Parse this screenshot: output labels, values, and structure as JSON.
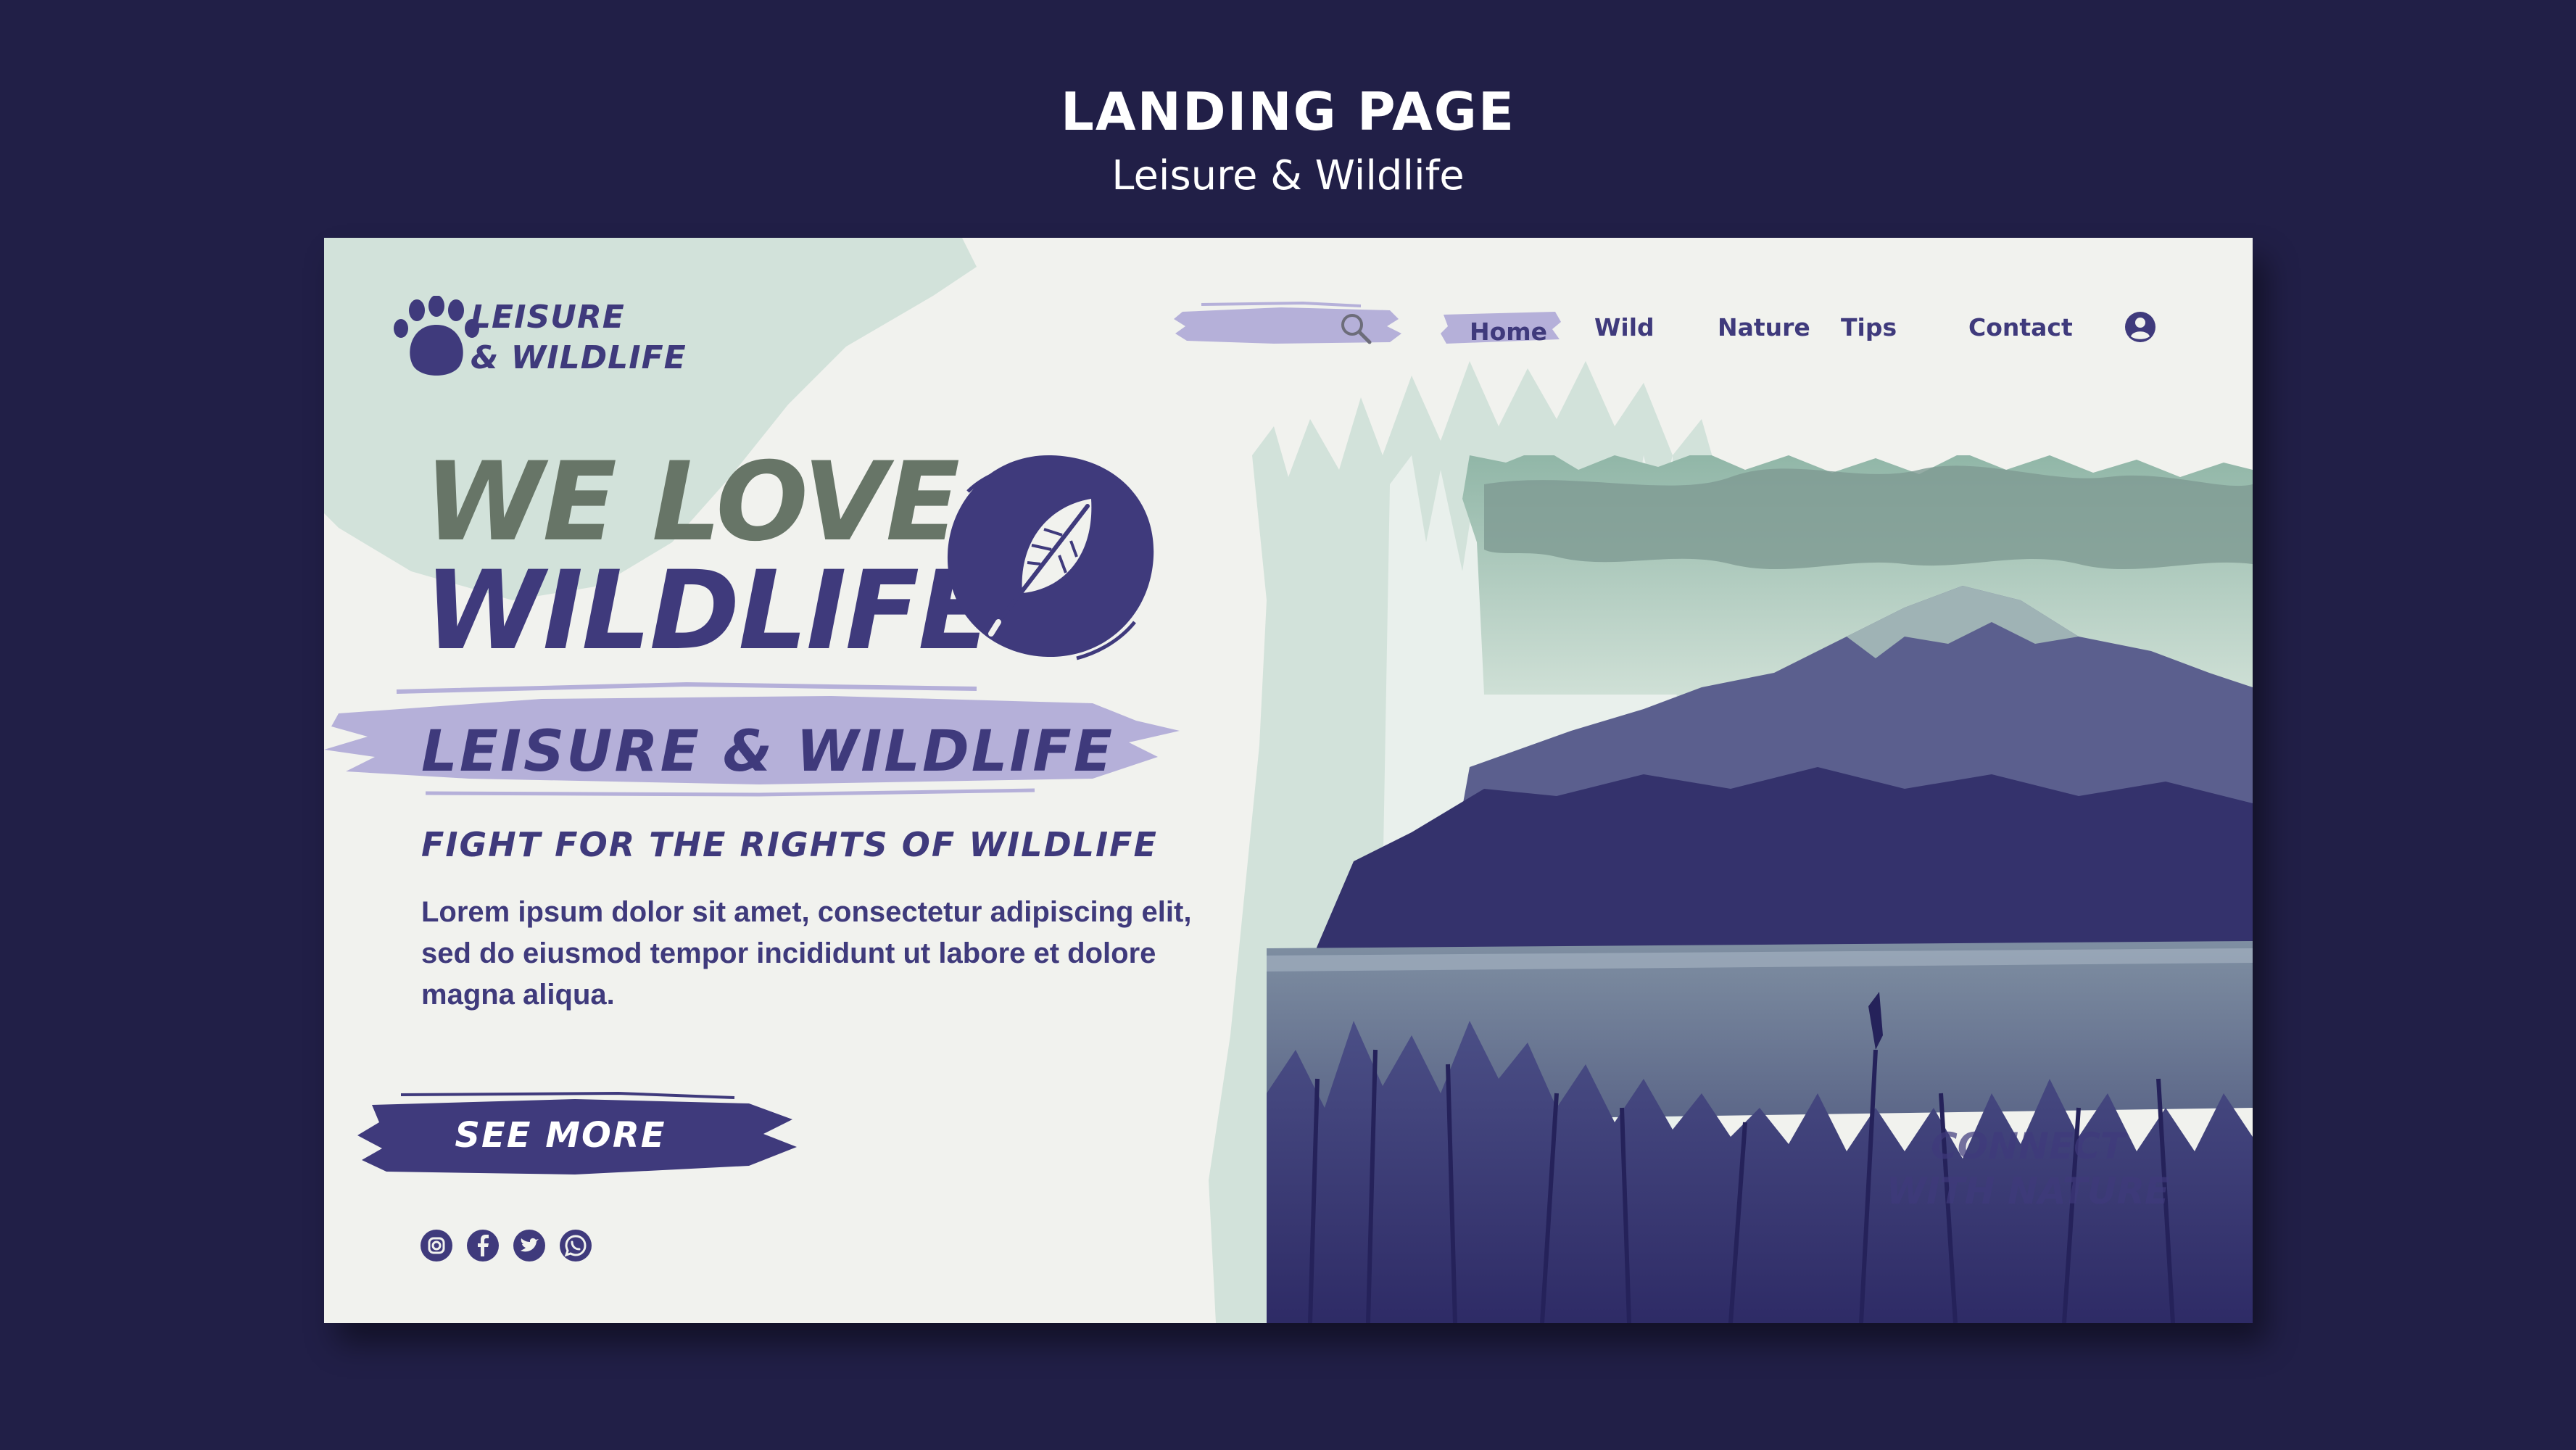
{
  "showcase": {
    "title": "LANDING PAGE",
    "subtitle": "Leisure & Wildlife"
  },
  "brand": {
    "line1": "LEISURE",
    "line2": "& WILDLIFE"
  },
  "search": {
    "placeholder": ""
  },
  "nav": {
    "home": "Home",
    "wild": "Wild",
    "nature": "Nature",
    "tips": "Tips",
    "contact": "Contact"
  },
  "hero": {
    "line1": "WE LOVE",
    "line2": "WILDLIFE",
    "tagline": "LEISURE & WILDLIFE",
    "subheading": "FIGHT FOR THE RIGHTS OF  WILDLIFE",
    "body": "Lorem ipsum dolor sit amet, consectetur adipiscing elit, sed do eiusmod tempor incididunt ut labore et dolore magna aliqua.",
    "cta_label": "SEE MORE"
  },
  "photo": {
    "overlay_text": "CONNECT WITH NATURE"
  },
  "social": [
    "instagram-icon",
    "facebook-icon",
    "twitter-icon",
    "whatsapp-icon"
  ],
  "colors": {
    "background": "#211f47",
    "card": "#f1f2ee",
    "primary": "#3f3a7c",
    "accent_lavender": "#b5b0d9",
    "accent_mint": "#d2e2da",
    "olive": "#677567"
  }
}
